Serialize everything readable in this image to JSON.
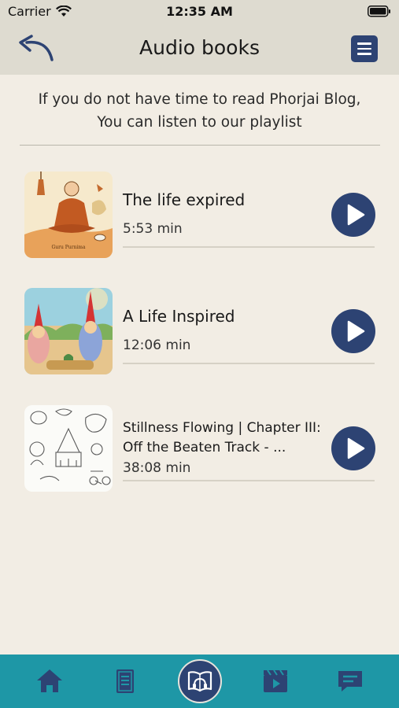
{
  "status_bar": {
    "carrier": "Carrier",
    "time": "12:35 AM",
    "wifi_icon": "wifi-icon",
    "battery_icon": "battery-icon"
  },
  "header": {
    "title": "Audio books",
    "back_icon": "back-arrow-icon",
    "menu_icon": "hamburger-menu-icon"
  },
  "intro": {
    "line1": "If you do not have time to read Phorjai Blog,",
    "line2": "You can listen to our playlist"
  },
  "tracks": [
    {
      "title": "The life expired",
      "duration": "5:53 min",
      "thumb_text": "Guru Purnima"
    },
    {
      "title": "A Life Inspired",
      "duration": "12:06 min"
    },
    {
      "title_line1": "Stillness Flowing | Chapter III:",
      "title_line2": "Off the Beaten Track - ...",
      "duration": "38:08 min"
    }
  ],
  "bottom_nav": {
    "items": [
      "home-icon",
      "book-icon",
      "audiobook-icon",
      "video-icon",
      "chat-icon"
    ],
    "active": "audiobook-icon"
  },
  "colors": {
    "background": "#f2ede4",
    "header": "#dedbd0",
    "accent": "#2d4373",
    "nav": "#1e97a6"
  }
}
